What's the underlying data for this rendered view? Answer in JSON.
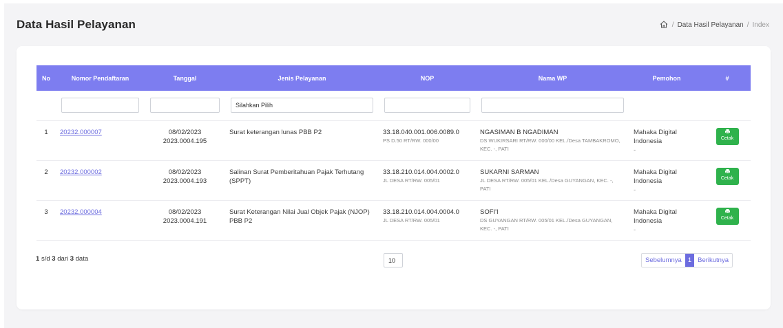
{
  "header": {
    "title": "Data Hasil Pelayanan",
    "breadcrumb": {
      "sep1": "/",
      "item1": "Data Hasil Pelayanan",
      "sep2": "/",
      "current": "Index"
    }
  },
  "table": {
    "columns": [
      "No",
      "Nomor Pendaftaran",
      "Tanggal",
      "Jenis Pelayanan",
      "NOP",
      "Nama WP",
      "Pemohon",
      "#"
    ],
    "filters": {
      "nomor": "",
      "tanggal": "",
      "jenis": "Silahkan Pilih",
      "nop": "",
      "nama": ""
    },
    "rows": [
      {
        "no": "1",
        "nomor": "20232.000007",
        "tanggal": "08/02/2023",
        "kode": "2023.0004.195",
        "jenis": "Surat keterangan lunas PBB P2",
        "nop": "33.18.040.001.006.0089.0",
        "nop_addr": "PS D.50 RT/RW. 000/00",
        "wp": "NGASIMAN B NGADIMAN",
        "wp_addr": "DS WUKIRSARI RT/RW. 000/00 KEL./Desa TAMBAKROMO, KEC. -, PATI",
        "pemohon": "Mahaka Digital Indonesia",
        "pemohon_extra": "-",
        "cetak": "Cetak"
      },
      {
        "no": "2",
        "nomor": "20232.000002",
        "tanggal": "08/02/2023",
        "kode": "2023.0004.193",
        "jenis": "Salinan Surat Pemberitahuan Pajak Terhutang (SPPT)",
        "nop": "33.18.210.014.004.0002.0",
        "nop_addr": "JL DESA RT/RW. 005/01",
        "wp": "SUKARNI SARMAN",
        "wp_addr": "JL DESA RT/RW. 005/01 KEL./Desa GUYANGAN, KEC. -, PATI",
        "pemohon": "Mahaka Digital Indonesia",
        "pemohon_extra": "-",
        "cetak": "Cetak"
      },
      {
        "no": "3",
        "nomor": "20232.000004",
        "tanggal": "08/02/2023",
        "kode": "2023.0004.191",
        "jenis": "Surat Keterangan Nilai Jual Objek Pajak (NJOP) PBB P2",
        "nop": "33.18.210.014.004.0004.0",
        "nop_addr": "JL DESA RT/RW. 005/01",
        "wp": "SOFI'I",
        "wp_addr": "DS GUYANGAN RT/RW. 005/01 KEL./Desa GUYANGAN, KEC. -, PATI",
        "pemohon": "Mahaka Digital Indonesia",
        "pemohon_extra": "-",
        "cetak": "Cetak"
      }
    ]
  },
  "footer": {
    "from": "1",
    "sd": "s/d",
    "to": "3",
    "dari": "dari",
    "total": "3",
    "data": "data",
    "page_size": "10",
    "prev": "Sebelumnya",
    "current_page": "1",
    "next": "Berikutnya"
  },
  "colors": {
    "header_bg": "#7d7df0",
    "link": "#6c6cdf",
    "print_button": "#2fb24c"
  },
  "icons": {
    "home": "home-icon",
    "print": "printer-icon"
  }
}
